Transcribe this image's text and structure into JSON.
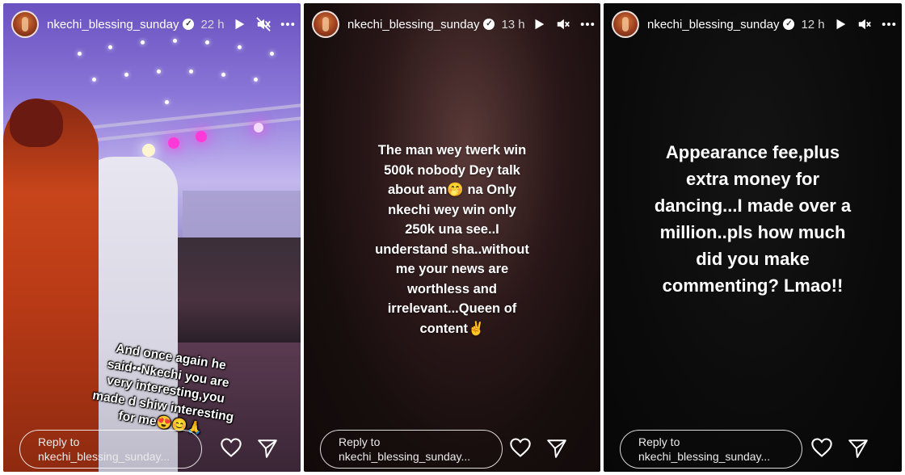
{
  "stories": [
    {
      "username": "nkechi_blessing_sunday",
      "time": "22 h",
      "icons": [
        "play-icon",
        "muted-icon",
        "more-icon"
      ],
      "text_lines": [
        "And once again he",
        "said••Nkechi you are",
        "very interesting,you",
        "made d shiw interesting",
        "for me😍😊🙏"
      ],
      "reply_label": "Reply to",
      "reply_target": "nkechi_blessing_sunday..."
    },
    {
      "username": "nkechi_blessing_sunday",
      "time": "13 h",
      "icons": [
        "play-icon",
        "muted-icon",
        "more-icon"
      ],
      "text_lines": [
        "The man wey twerk win",
        "500k nobody Dey talk",
        "about am🤭 na Only",
        "nkechi wey win only",
        "250k una see..I",
        "understand sha..without",
        "me your news are",
        "worthless and",
        "irrelevant...Queen of",
        "content✌️"
      ],
      "reply_label": "Reply to",
      "reply_target": "nkechi_blessing_sunday..."
    },
    {
      "username": "nkechi_blessing_sunday",
      "time": "12 h",
      "icons": [
        "play-icon",
        "muted-icon",
        "more-icon"
      ],
      "text_lines": [
        "Appearance fee,plus",
        "extra money for",
        "dancing...I made over a",
        "million..pls  how much",
        "did you make",
        "commenting? Lmao!!"
      ],
      "reply_label": "Reply to",
      "reply_target": "nkechi_blessing_sunday..."
    }
  ],
  "colors": {
    "text": "#ffffff",
    "reply_border": "#ffffff"
  }
}
